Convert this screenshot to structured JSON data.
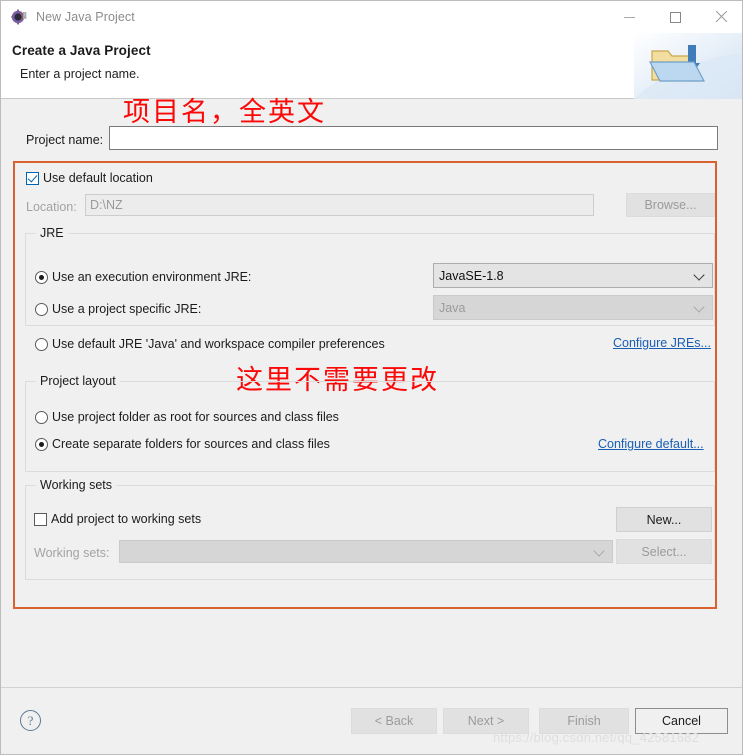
{
  "window": {
    "title": "New Java Project",
    "icon": "eclipse-java-project-icon",
    "controls": {
      "minimize": "minimize-icon",
      "maximize": "maximize-icon",
      "close": "close-icon"
    }
  },
  "header": {
    "title": "Create a Java Project",
    "subtitle": "Enter a project name.",
    "art_icon": "folder-with-down-arrow-icon"
  },
  "annotations": {
    "project_name_note": "项目名，全英文",
    "layout_note": "这里不需要更改",
    "color": "#fb0808",
    "highlight_box_color": "#d9602f"
  },
  "project_name": {
    "label": "Project name:",
    "value": "",
    "placeholder": ""
  },
  "location": {
    "use_default_label": "Use default location",
    "use_default_checked": true,
    "label": "Location:",
    "value": "D:\\NZ",
    "browse_label": "Browse..."
  },
  "jre": {
    "legend": "JRE",
    "options": [
      {
        "label": "Use an execution environment JRE:",
        "selected": true
      },
      {
        "label": "Use a project specific JRE:",
        "selected": false
      },
      {
        "label": "Use default JRE 'Java' and workspace compiler preferences",
        "selected": false
      }
    ],
    "environment_combo": {
      "value": "JavaSE-1.8",
      "disabled": false
    },
    "specific_combo": {
      "value": "Java",
      "disabled": true
    },
    "configure_link": "Configure JREs..."
  },
  "project_layout": {
    "legend": "Project layout",
    "options": [
      {
        "label": "Use project folder as root for sources and class files",
        "selected": false
      },
      {
        "label": "Create separate folders for sources and class files",
        "selected": true
      }
    ],
    "configure_link": "Configure default..."
  },
  "working_sets": {
    "legend": "Working sets",
    "add_label": "Add project to working sets",
    "add_checked": false,
    "new_label": "New...",
    "sets_label": "Working sets:",
    "sets_value": "",
    "select_label": "Select..."
  },
  "footer": {
    "help_icon": "help-question-icon",
    "buttons": [
      {
        "label": "< Back",
        "enabled": false
      },
      {
        "label": "Next >",
        "enabled": false
      },
      {
        "label": "Finish",
        "enabled": false
      },
      {
        "label": "Cancel",
        "enabled": true
      }
    ],
    "watermark": "https://blog.csdn.net/qq_42581682"
  }
}
